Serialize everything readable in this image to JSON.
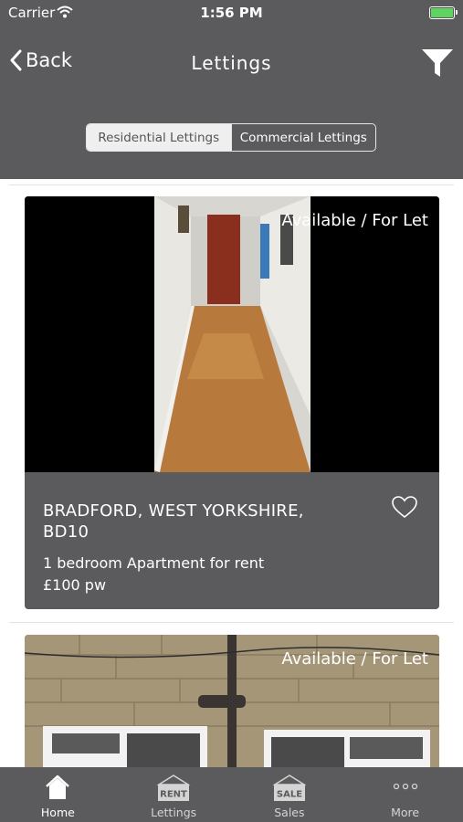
{
  "status_bar": {
    "carrier": "Carrier",
    "time": "1:56 PM"
  },
  "nav": {
    "back_label": "Back",
    "title": "Lettings"
  },
  "segments": [
    {
      "label": "Residential Lettings",
      "selected": true
    },
    {
      "label": "Commercial Lettings",
      "selected": false
    }
  ],
  "listings": [
    {
      "status": "Available / For Let",
      "address": "BRADFORD, WEST YORKSHIRE, BD10",
      "description": "1 bedroom Apartment for rent",
      "price": "£100 pw",
      "favorited": false
    },
    {
      "status": "Available / For Let"
    }
  ],
  "tabbar": [
    {
      "label": "Home",
      "icon": "home-icon",
      "badge": ""
    },
    {
      "label": "Lettings",
      "icon": "rent-sign-icon",
      "badge": "RENT"
    },
    {
      "label": "Sales",
      "icon": "sale-sign-icon",
      "badge": "SALE"
    },
    {
      "label": "More",
      "icon": "more-icon",
      "badge": ""
    }
  ],
  "colors": {
    "bar": "#5b5b5d",
    "battery": "#5fd35f",
    "segment_active": "#efefef"
  }
}
